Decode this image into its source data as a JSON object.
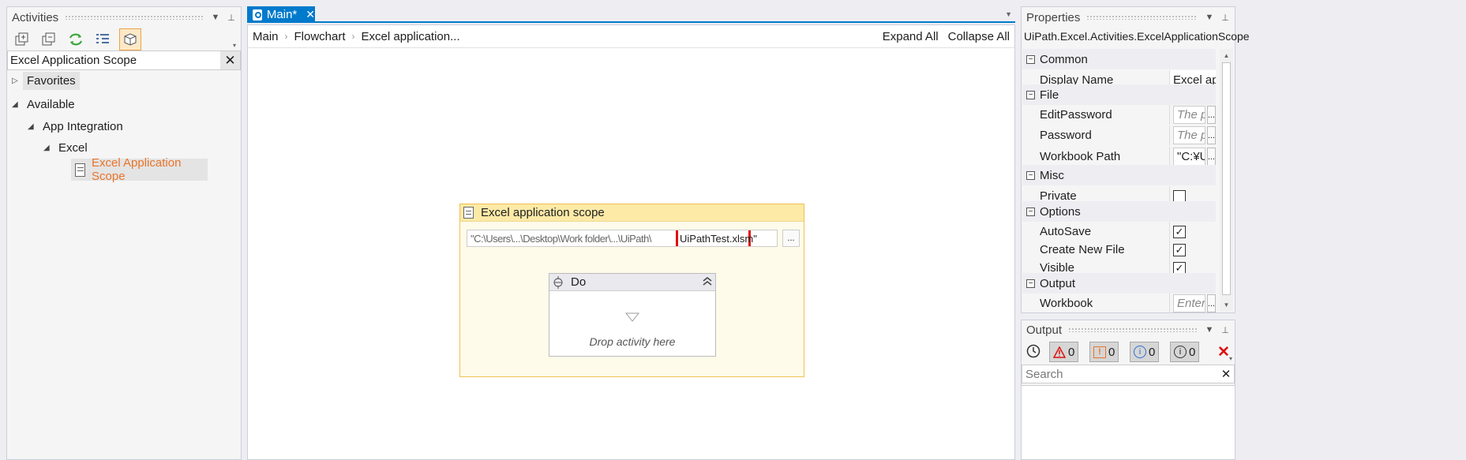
{
  "activities": {
    "title": "Activities",
    "search_value": "Excel Application Scope",
    "tree": {
      "favorites": "Favorites",
      "available": "Available",
      "app_integration": "App Integration",
      "excel": "Excel",
      "excel_app_scope": "Excel Application Scope"
    }
  },
  "designer": {
    "tab_label": "Main*",
    "breadcrumb": [
      "Main",
      "Flowchart",
      "Excel application..."
    ],
    "expand_all": "Expand All",
    "collapse_all": "Collapse All",
    "scope": {
      "title": "Excel application scope",
      "path_prefix": "\"C:\\Users\\...\\Desktop\\Work folder\\...\\UiPath\\",
      "path_highlight": "UiPathTest.xlsm\"",
      "ellipsis": "...",
      "do_title": "Do",
      "drop_hint": "Drop activity here"
    }
  },
  "properties": {
    "title": "Properties",
    "type_name": "UiPath.Excel.Activities.ExcelApplicationScope",
    "categories": {
      "common": "Common",
      "file": "File",
      "misc": "Misc",
      "options": "Options",
      "output": "Output"
    },
    "display_name_label": "Display Name",
    "display_name_value": "Excel applicatic",
    "edit_password_label": "EditPassword",
    "edit_password_ph": "The passw",
    "password_label": "Password",
    "password_ph": "The passw",
    "workbook_path_label": "Workbook Path",
    "workbook_path_value": "\"C:¥Users¥",
    "private_label": "Private",
    "private_checked": false,
    "autosave_label": "AutoSave",
    "create_new_label": "Create New File",
    "visible_label": "Visible",
    "workbook_label": "Workbook",
    "workbook_ph": "Enter a VE",
    "ellipsis": "..."
  },
  "output": {
    "title": "Output",
    "counts": {
      "errors": "0",
      "warnings": "0",
      "info": "0",
      "trace": "0"
    },
    "search_placeholder": "Search"
  },
  "colors": {
    "accent": "#007acc",
    "orange": "#e8742a",
    "scope_fill": "#fffbea",
    "scope_header": "#fdeaa7",
    "highlight_red": "#e01010"
  }
}
